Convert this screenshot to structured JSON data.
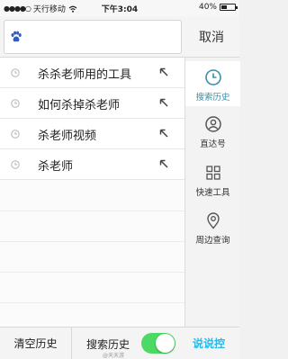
{
  "status_bar": {
    "signal": "●●●●○",
    "carrier": "天行移动",
    "time": "下午3:04",
    "battery": "40%",
    "battery_level": 0.4
  },
  "search": {
    "value": "",
    "placeholder": "",
    "cancel_label": "取消"
  },
  "history": {
    "items": [
      {
        "label": "杀杀老师用的工具"
      },
      {
        "label": "如何杀掉杀老师"
      },
      {
        "label": "杀老师视频"
      },
      {
        "label": "杀老师"
      }
    ]
  },
  "side_nav": {
    "items": [
      {
        "label": "搜索历史",
        "icon": "clock-icon",
        "active": true
      },
      {
        "label": "直达号",
        "icon": "person-icon",
        "active": false
      },
      {
        "label": "快速工具",
        "icon": "grid-icon",
        "active": false
      },
      {
        "label": "周边查询",
        "icon": "location-pin-icon",
        "active": false
      }
    ]
  },
  "bottom_bar": {
    "clear_label": "清空历史",
    "toggle_label": "搜索历史",
    "toggle_on": true,
    "watermark_small": "@天天游",
    "watermark_logo": "说说控"
  },
  "colors": {
    "accent": "#3a8fa8",
    "toggle_on": "#4cd964",
    "logo": "#2bb8e6"
  }
}
